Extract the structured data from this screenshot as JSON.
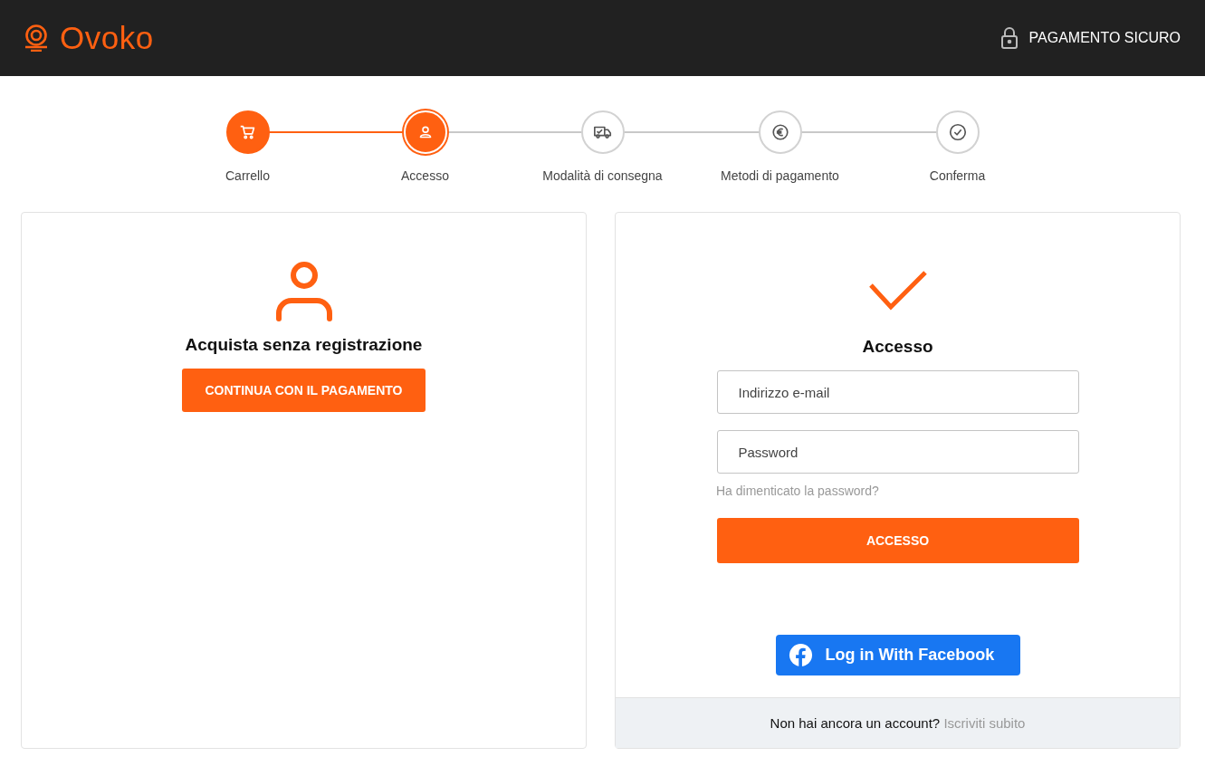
{
  "header": {
    "brand": "Ovoko",
    "secure_label": "PAGAMENTO SICURO"
  },
  "steps": [
    {
      "label": "Carrello",
      "kind": "cart",
      "completed": true,
      "selected": false
    },
    {
      "label": "Accesso",
      "kind": "user",
      "completed": false,
      "selected": true
    },
    {
      "label": "Modalità di consegna",
      "kind": "truck",
      "completed": false,
      "selected": false
    },
    {
      "label": "Metodi di pagamento",
      "kind": "euro",
      "completed": false,
      "selected": false
    },
    {
      "label": "Conferma",
      "kind": "check",
      "completed": false,
      "selected": false
    }
  ],
  "guest": {
    "title": "Acquista senza registrazione",
    "button": "CONTINUA CON IL PAGAMENTO"
  },
  "login": {
    "title": "Accesso",
    "email": {
      "placeholder": "Indirizzo e-mail"
    },
    "password": {
      "placeholder": "Password"
    },
    "forgot_link": "Ha dimenticato la password?",
    "button": "ACCESSO",
    "facebook_button": "Log in With Facebook",
    "footer_text": "Non hai ancora un account?",
    "signup_link": "Iscriviti subito"
  }
}
